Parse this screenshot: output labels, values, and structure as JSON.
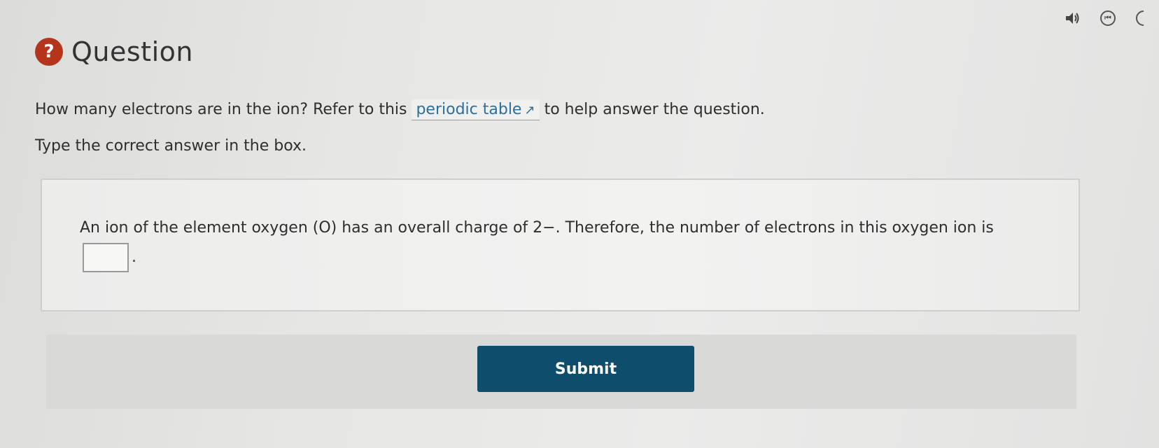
{
  "toolbar": {
    "audio_icon": "speaker-icon",
    "step_icon": "step-back-icon",
    "step_glyph": "⏮"
  },
  "question": {
    "badge": "?",
    "title": "Question",
    "prompt_before": "How many electrons are in the ion? Refer to this",
    "link_text": "periodic table",
    "prompt_after": "to help answer the question.",
    "instruction": "Type the correct answer in the box."
  },
  "answer": {
    "statement": "An ion of the element oxygen (O) has an overall charge of 2−. Therefore, the number of electrons in this oxygen ion is",
    "input_value": "",
    "period": "."
  },
  "submit": {
    "label": "Submit"
  },
  "colors": {
    "badge": "#b5341c",
    "link": "#2a6f9e",
    "submit_bg": "#0e4d6c"
  }
}
